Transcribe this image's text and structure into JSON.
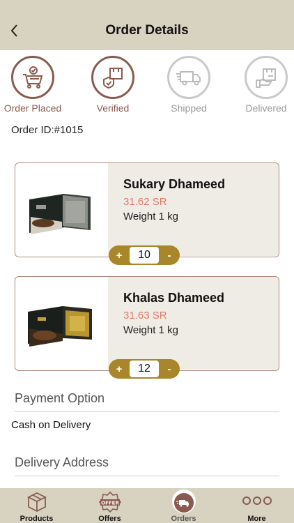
{
  "header": {
    "title": "Order Details"
  },
  "steps": [
    {
      "label": "Order Placed",
      "icon": "cart-check-icon",
      "active": true
    },
    {
      "label": "Verified",
      "icon": "verified-box-icon",
      "active": true
    },
    {
      "label": "Shipped",
      "icon": "truck-icon",
      "active": false
    },
    {
      "label": "Delivered",
      "icon": "delivered-box-icon",
      "active": false
    }
  ],
  "order": {
    "id_text": "Order ID:#1015"
  },
  "items": [
    {
      "name": "Sukary Dhameed",
      "price": "31.62 SR",
      "weight": "Weight 1 kg",
      "qty": "10",
      "plus": "+",
      "minus": "-"
    },
    {
      "name": "Khalas Dhameed",
      "price": "31.63 SR",
      "weight": "Weight 1 kg",
      "qty": "12",
      "plus": "+",
      "minus": "-"
    }
  ],
  "payment": {
    "title": "Payment Option",
    "value": "Cash on Delivery"
  },
  "delivery": {
    "title": "Delivery Address"
  },
  "tabs": [
    {
      "label": "Products",
      "icon": "box-icon"
    },
    {
      "label": "Offers",
      "icon": "offer-badge-icon"
    },
    {
      "label": "Orders",
      "icon": "delivery-truck-icon",
      "active": true
    },
    {
      "label": "More",
      "icon": "more-dots-icon"
    }
  ],
  "colors": {
    "header_bg": "#d8d3c1",
    "accent": "#8a5a4e",
    "price": "#e07a6a",
    "qty_bg": "#a9862a"
  }
}
